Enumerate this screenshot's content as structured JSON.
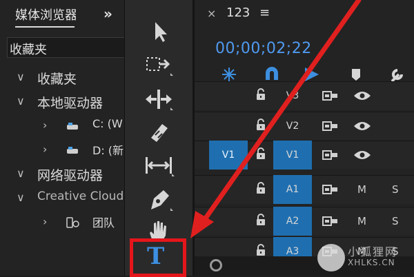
{
  "left_panel": {
    "tab_title": "媒体浏览器",
    "more_glyph": "»",
    "field_text": "收藏夹",
    "tree": [
      {
        "chevron": "∨",
        "label": "收藏夹",
        "indent": 0,
        "icon": ""
      },
      {
        "chevron": "∨",
        "label": "本地驱动器",
        "indent": 0,
        "icon": ""
      },
      {
        "chevron": "›",
        "label": "C: (W",
        "indent": 1,
        "icon": "drive-icon"
      },
      {
        "chevron": "›",
        "label": "D: (新",
        "indent": 1,
        "icon": "drive-icon"
      },
      {
        "chevron": "∨",
        "label": "网络驱动器",
        "indent": 0,
        "icon": ""
      },
      {
        "chevron": "∨",
        "label": "Creative Cloud",
        "indent": 0,
        "icon": ""
      },
      {
        "chevron": "›",
        "label": "团队",
        "indent": 1,
        "icon": "team-project-icon"
      }
    ]
  },
  "toolbar": {
    "tools": [
      "selection-tool",
      "track-select-tool",
      "ripple-edit-tool",
      "razor-tool",
      "slip-tool",
      "pen-tool",
      "hand-tool",
      "type-tool"
    ],
    "type_tool_glyph": "T",
    "highlight_color": "#e5161b"
  },
  "timeline": {
    "close_glyph": "×",
    "sequence_name": "123",
    "menu_glyph": "≡",
    "timecode": "00;00;02;22",
    "accent_color": "#1f6fb0",
    "tracks": [
      {
        "source": "",
        "target": "V3",
        "kind": "video"
      },
      {
        "source": "",
        "target": "V2",
        "kind": "video"
      },
      {
        "source": "V1",
        "target": "V1",
        "kind": "video"
      },
      {
        "source": "",
        "target": "A1",
        "kind": "audio",
        "mute": "M",
        "solo": "S"
      },
      {
        "source": "",
        "target": "A2",
        "kind": "audio",
        "mute": "M",
        "solo": "S"
      },
      {
        "source": "",
        "target": "A3",
        "kind": "audio",
        "mute": "M",
        "solo": "S"
      }
    ]
  },
  "watermark": {
    "text_cn": "小狐狸网",
    "text_en": "XHLKS.CN"
  }
}
